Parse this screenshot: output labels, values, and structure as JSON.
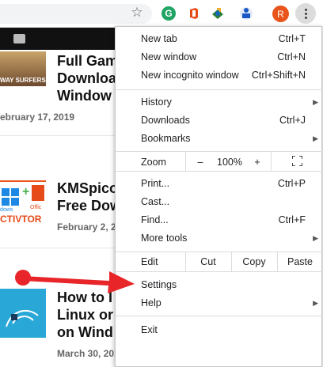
{
  "toolbar": {
    "bookmark_icon": "star-icon",
    "extension_g": "G",
    "avatar_initial": "R",
    "menu_icon": "three-dot-menu-icon"
  },
  "page": {
    "posts": [
      {
        "title": "Full Gam\nDownloa\nWindow",
        "date": "ebruary 17, 2019",
        "thumb_text": "WAY SURFERS"
      },
      {
        "title": "KMSpico\nFree Dow",
        "date": "February 2, 20",
        "thumb_text_1": "dows",
        "thumb_text_2": "Offic",
        "thumb_text_3": "CTIVTOR"
      },
      {
        "title": "How to I\nLinux or\non Wind",
        "date": "March 30, 2019"
      }
    ]
  },
  "menu": {
    "new_tab": {
      "label": "New tab",
      "shortcut": "Ctrl+T"
    },
    "new_window": {
      "label": "New window",
      "shortcut": "Ctrl+N"
    },
    "new_incognito": {
      "label": "New incognito window",
      "shortcut": "Ctrl+Shift+N"
    },
    "history": {
      "label": "History"
    },
    "downloads": {
      "label": "Downloads",
      "shortcut": "Ctrl+J"
    },
    "bookmarks": {
      "label": "Bookmarks"
    },
    "zoom": {
      "label": "Zoom",
      "minus": "–",
      "value": "100%",
      "plus": "+"
    },
    "print": {
      "label": "Print...",
      "shortcut": "Ctrl+P"
    },
    "cast": {
      "label": "Cast..."
    },
    "find": {
      "label": "Find...",
      "shortcut": "Ctrl+F"
    },
    "more_tools": {
      "label": "More tools"
    },
    "edit": {
      "label": "Edit",
      "cut": "Cut",
      "copy": "Copy",
      "paste": "Paste"
    },
    "settings": {
      "label": "Settings"
    },
    "help": {
      "label": "Help"
    },
    "exit": {
      "label": "Exit"
    }
  },
  "colors": {
    "annotation_arrow": "#e8262a",
    "avatar": "#e8541a"
  }
}
